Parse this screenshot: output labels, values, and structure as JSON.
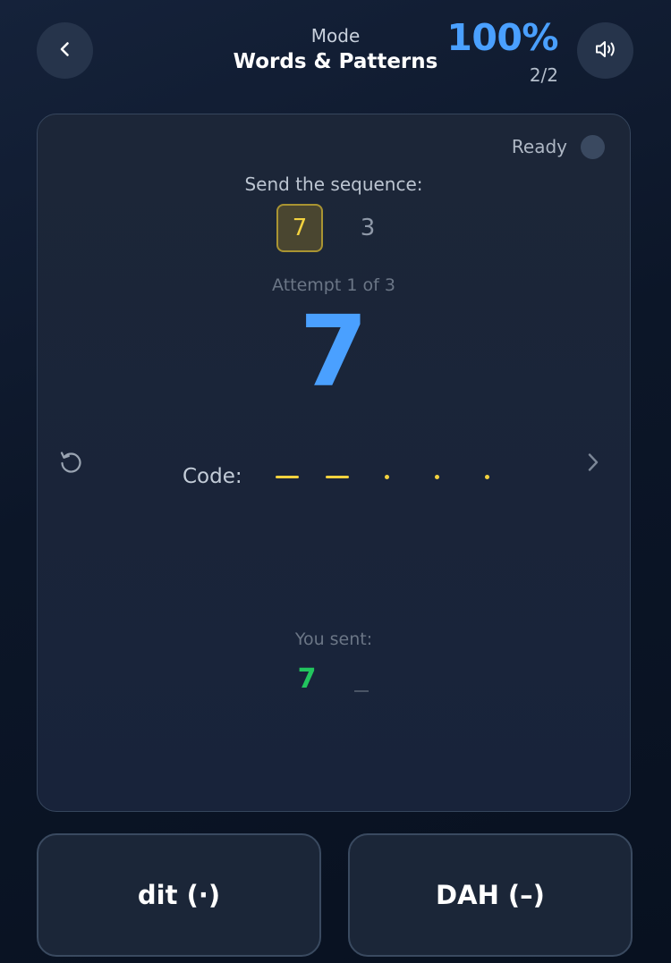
{
  "header": {
    "mode_label": "Mode",
    "mode_title": "Words & Patterns",
    "score_percent": "100%",
    "score_count": "2/2",
    "back_icon": "chevron-left-icon",
    "sound_icon": "speaker-icon"
  },
  "card": {
    "status_label": "Ready",
    "prompt": "Send the sequence:",
    "sequence": [
      "7",
      "3"
    ],
    "current_index": 0,
    "attempt": "Attempt 1 of 3",
    "current_char": "7",
    "code_label": "Code:",
    "code_symbols": [
      "dah",
      "dah",
      "dit",
      "dit",
      "dit"
    ],
    "you_sent_label": "You sent:",
    "sent_chars": [
      "7"
    ]
  },
  "keys": {
    "dit_label": "dit (·)",
    "dah_label": "DAH (–)"
  },
  "colors": {
    "accent_blue": "#4aa0ff",
    "code_yellow": "#f3d23f",
    "correct_green": "#22c55e"
  }
}
